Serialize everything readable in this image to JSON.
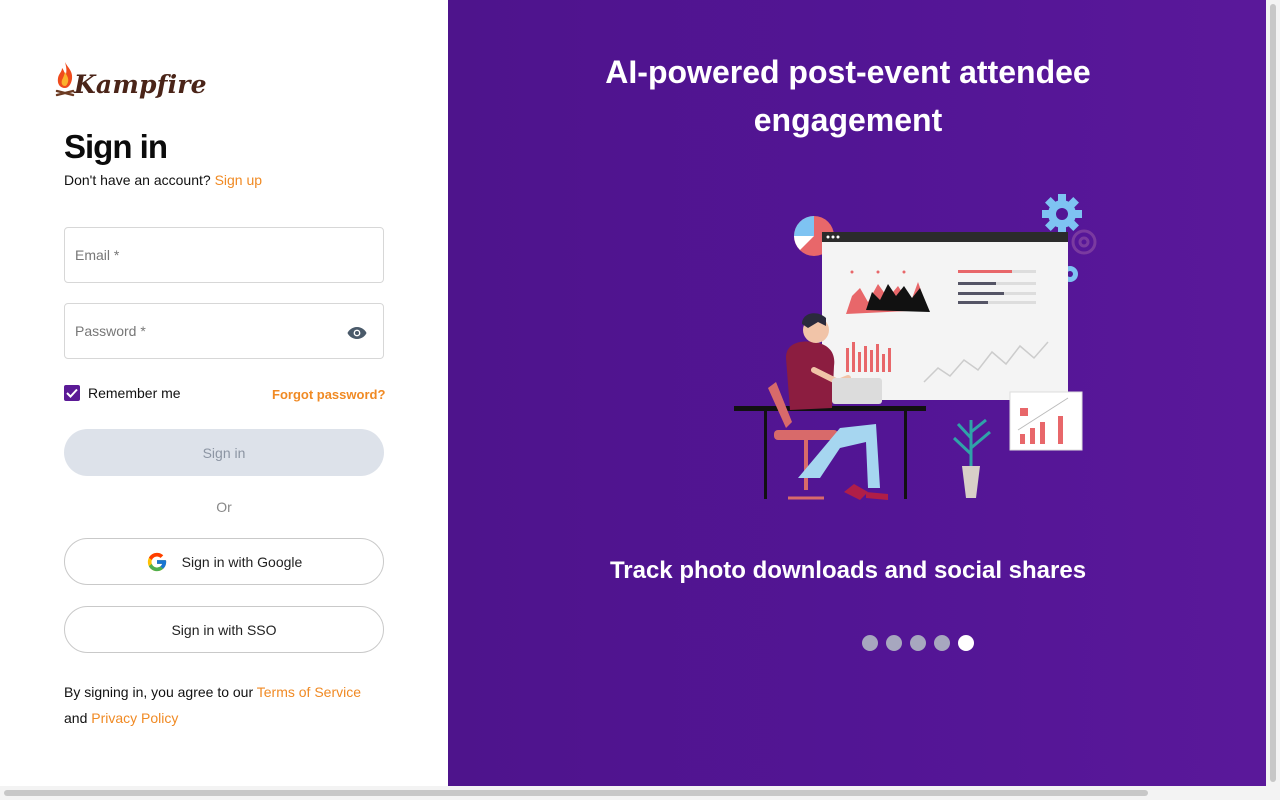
{
  "brand": {
    "name": "Kampfire"
  },
  "signin": {
    "title": "Sign in",
    "no_account_text": "Don't have an account?",
    "signup_link": "Sign up",
    "email_placeholder": "Email *",
    "password_placeholder": "Password *",
    "remember_label": "Remember me",
    "remember_checked": true,
    "forgot_link": "Forgot password?",
    "submit_label": "Sign in",
    "or_label": "Or",
    "google_label": "Sign in with Google",
    "sso_label": "Sign in with SSO",
    "terms_prefix": "By signing in, you agree to our",
    "terms_link": "Terms of Service",
    "and_text": "and",
    "privacy_link": "Privacy Policy"
  },
  "hero": {
    "title_line1": "AI-powered post-event attendee",
    "title_line2": "engagement",
    "caption": "Track photo downloads and social shares",
    "slide_count": 5,
    "active_slide": 5
  },
  "colors": {
    "accent": "#f08a24",
    "brand_purple": "#531595",
    "disabled_button": "#dde2ea"
  }
}
